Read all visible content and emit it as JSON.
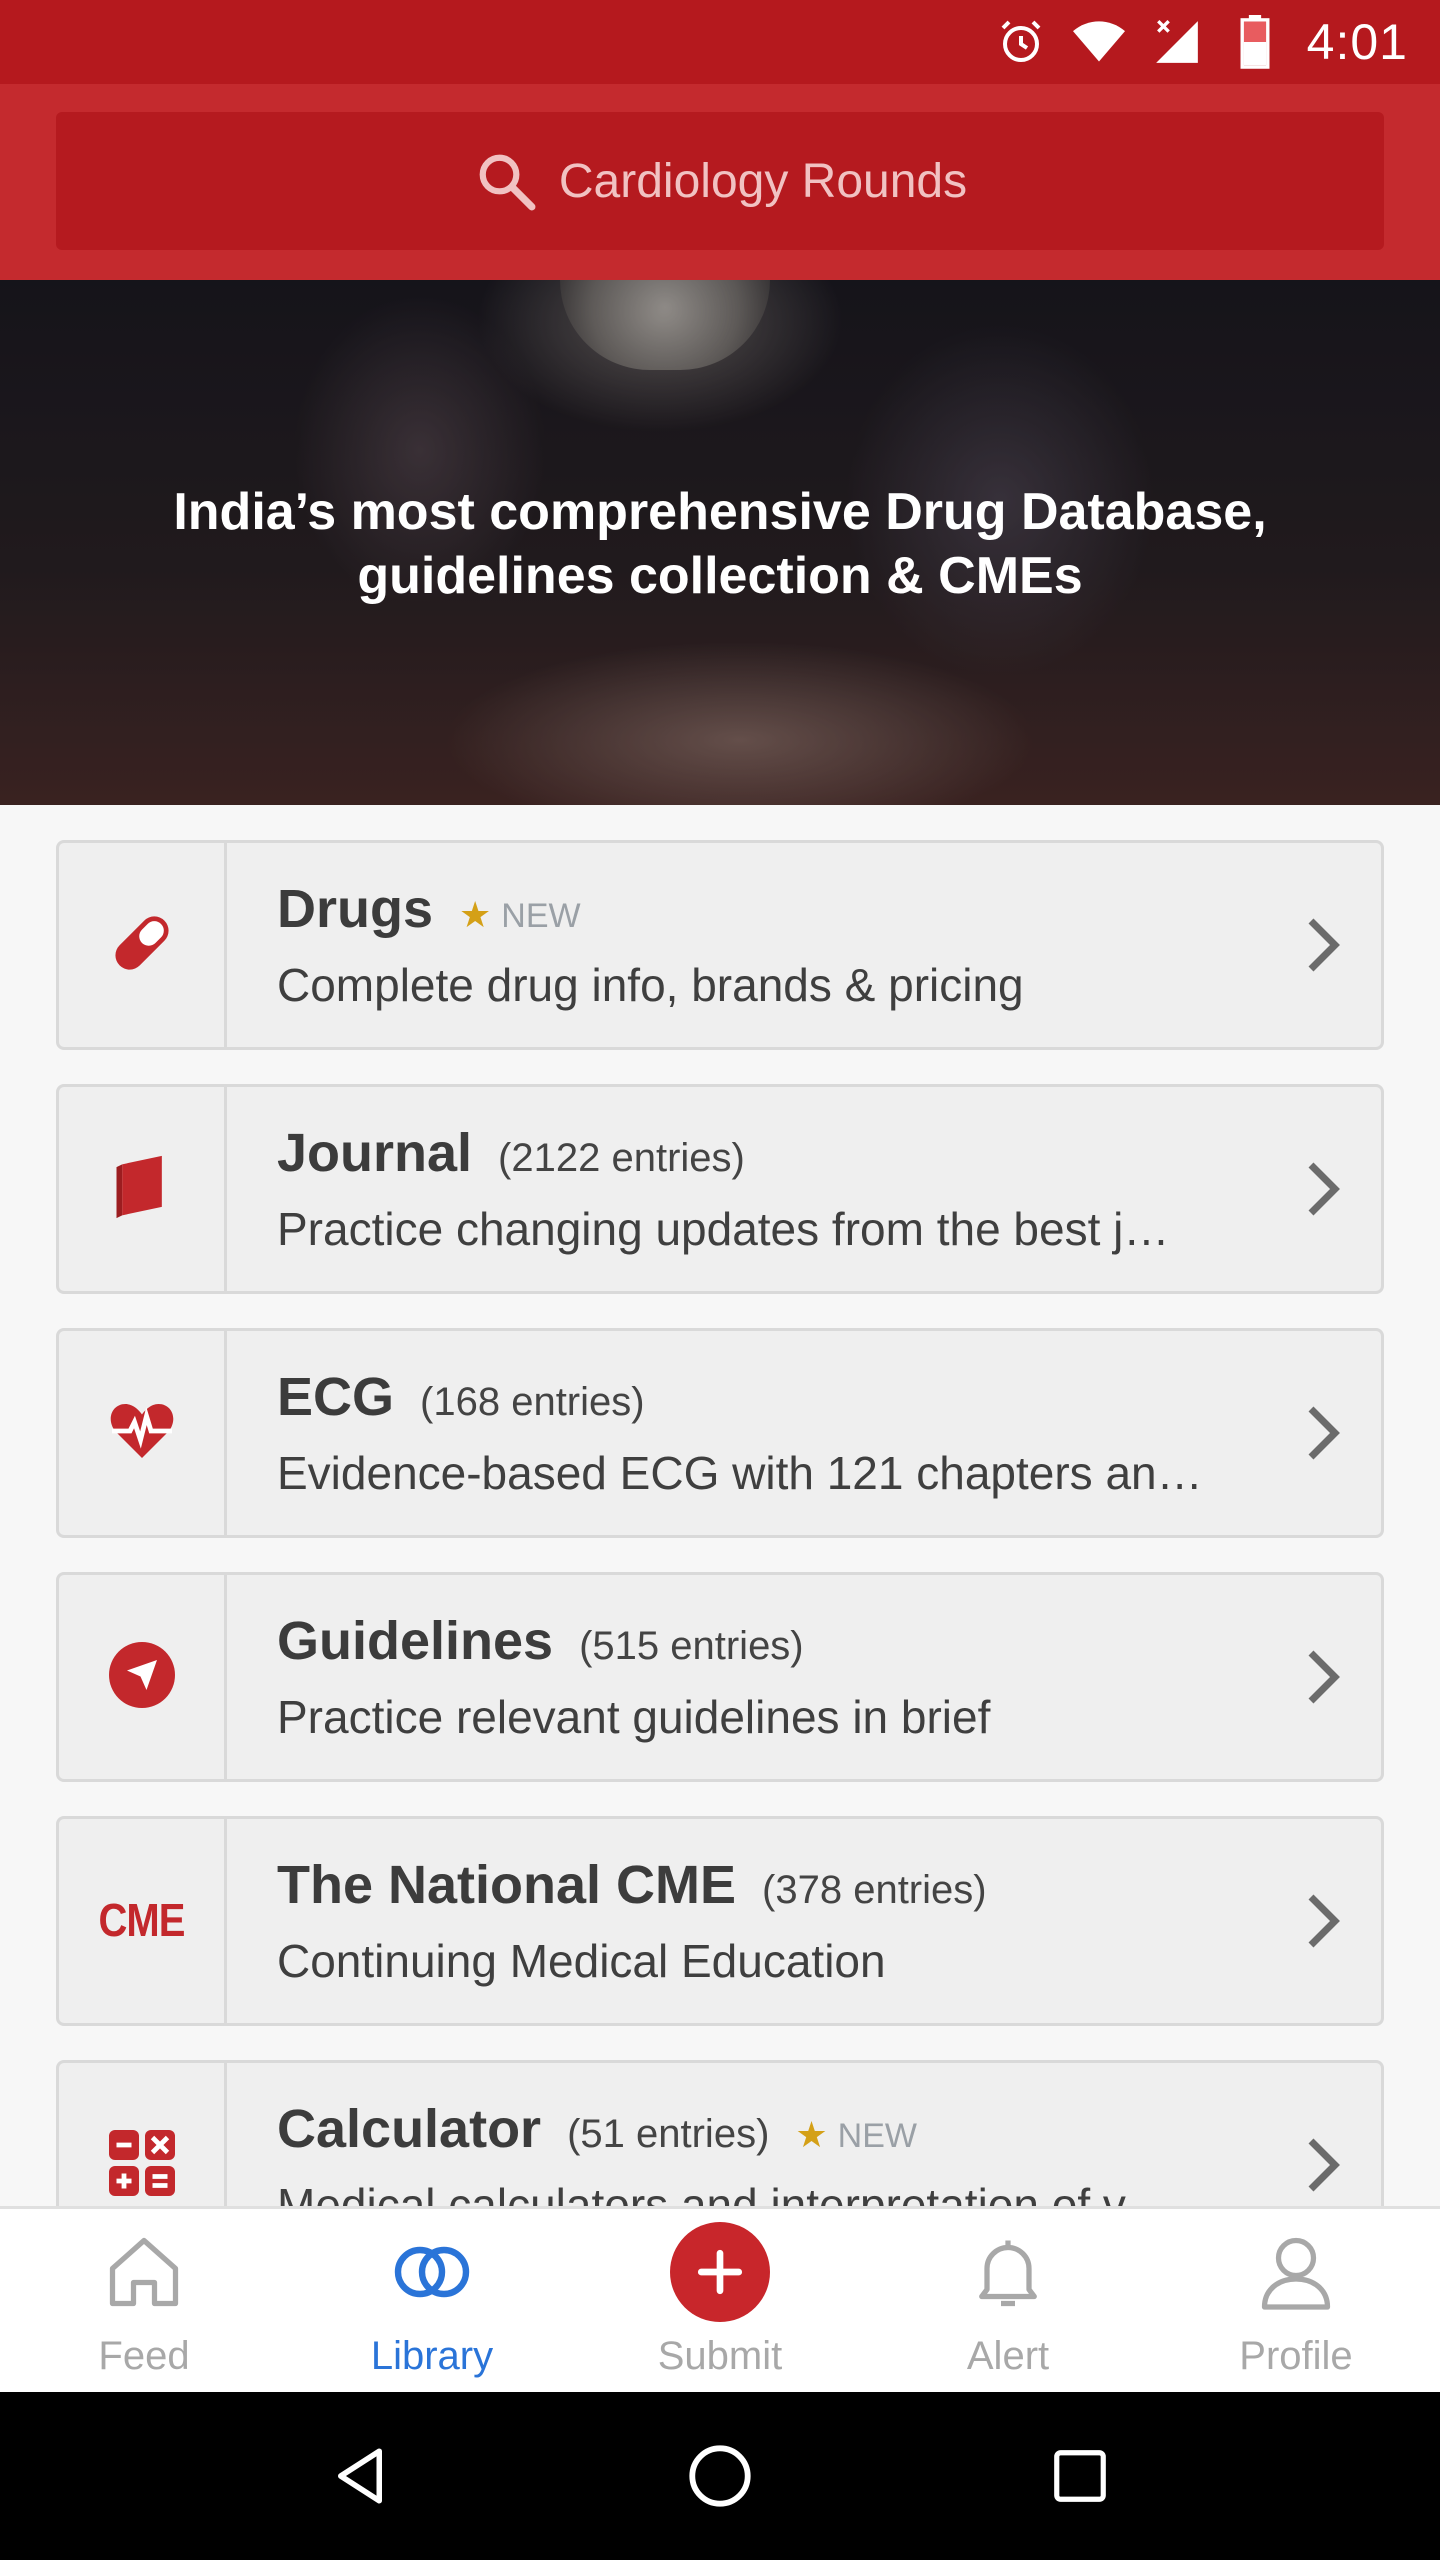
{
  "status_bar": {
    "time": "4:01",
    "icons": [
      "alarm-icon",
      "wifi-icon",
      "signal-icon",
      "battery-icon"
    ]
  },
  "search": {
    "placeholder": "Cardiology Rounds",
    "icon": "search-icon"
  },
  "hero": {
    "line1": "India’s most comprehensive Drug Database,",
    "line2": "guidelines collection & CMEs"
  },
  "library": {
    "items": [
      {
        "title": "Drugs",
        "count": "",
        "new_label": "NEW",
        "subtitle": "Complete drug info, brands & pricing",
        "icon": "pill-icon"
      },
      {
        "title": "Journal",
        "count": "(2122 entries)",
        "new_label": "",
        "subtitle": "Practice changing updates from the best j…",
        "icon": "book-icon"
      },
      {
        "title": "ECG",
        "count": "(168 entries)",
        "new_label": "",
        "subtitle": "Evidence-based ECG with 121 chapters an…",
        "icon": "heart-pulse-icon"
      },
      {
        "title": "Guidelines",
        "count": "(515 entries)",
        "new_label": "",
        "subtitle": "Practice relevant guidelines in brief",
        "icon": "compass-icon"
      },
      {
        "title": "The National CME",
        "count": "(378 entries)",
        "new_label": "",
        "subtitle": "Continuing Medical Education",
        "icon": "cme-icon",
        "icon_text": "CME"
      },
      {
        "title": "Calculator",
        "count": "(51 entries)",
        "new_label": "NEW",
        "subtitle": "Medical calculators and interpretation of v…",
        "icon": "calculator-icon"
      }
    ]
  },
  "bottom_nav": {
    "items": [
      {
        "label": "Feed",
        "icon": "home-icon",
        "active": false
      },
      {
        "label": "Library",
        "icon": "library-rings-icon",
        "active": true
      },
      {
        "label": "Submit",
        "icon": "plus-circle-icon",
        "active": false
      },
      {
        "label": "Alert",
        "icon": "bell-icon",
        "active": false
      },
      {
        "label": "Profile",
        "icon": "person-icon",
        "active": false
      }
    ]
  },
  "colors": {
    "brand_red": "#c42a2e",
    "status_red": "#b5191e",
    "active_blue": "#2a74d8",
    "star_gold": "#d4a017"
  }
}
